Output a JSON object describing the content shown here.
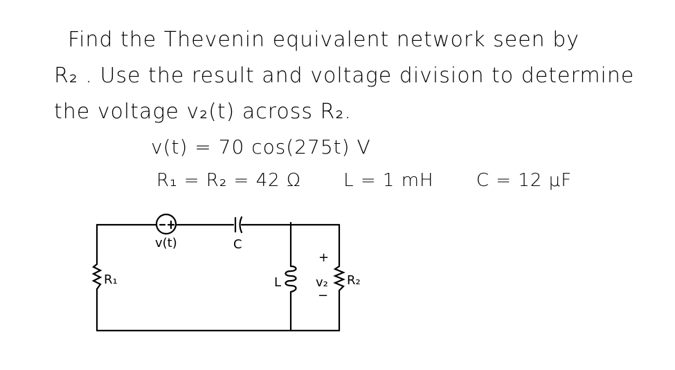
{
  "problem": {
    "line1": "Find the Thevenin equivalent network seen by",
    "line2": "R₂ . Use the result and voltage division to determine",
    "line3": "the voltage v₂(t) across R₂.",
    "source_equation": "v(t) = 70 cos(275t)  V",
    "given": {
      "resistors": "R₁ = R₂ = 42 Ω",
      "inductor": "L = 1 mH",
      "capacitor": "C = 12 μF"
    }
  },
  "circuit": {
    "labels": {
      "source": "v(t)",
      "capacitor": "C",
      "r1": "R₁",
      "inductor": "L",
      "r2": "R₂",
      "v2": "v₂",
      "plus": "+",
      "minus": "−"
    }
  }
}
